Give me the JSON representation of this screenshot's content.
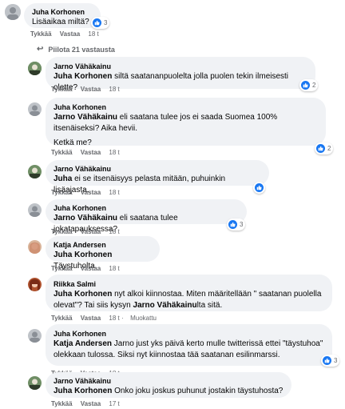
{
  "top_comment": {
    "author": "Juha Korhonen",
    "text": "Lisäaikaa miltä?",
    "likes": "3",
    "actions": {
      "like": "Tykkää",
      "reply": "Vastaa",
      "time": "18 t"
    }
  },
  "hide_replies": "Piilota 21 vastausta",
  "replies": [
    {
      "author": "Jarno Vähäkainu",
      "mention": "Juha Korhonen",
      "text": " siltä saatananpuolelta jolla puolen tekin ilmeisesti olette?",
      "likes": "2",
      "like": "Tykkää",
      "reply": "Vastaa",
      "time": "18 t"
    },
    {
      "author": "Juha Korhonen",
      "mention": "Jarno Vähäkainu",
      "text": " eli saatana tulee jos ei saada Suomea 100% itsenäiseksi? Aika hevii.",
      "text2": "Ketkä me?",
      "likes": "2",
      "like": "Tykkää",
      "reply": "Vastaa",
      "time": "18 t"
    },
    {
      "author": "Jarno Vähäkainu",
      "mention": "Juha",
      "text": " ei se itsenäisyys pelasta mitään, puhuinkin lisäajasta.",
      "likes": "",
      "like": "Tykkää",
      "reply": "Vastaa",
      "time": "18 t"
    },
    {
      "author": "Juha Korhonen",
      "mention": "Jarno Vähäkainu",
      "text": " eli saatana tulee jokatapauksessa?",
      "likes": "3",
      "like": "Tykkää",
      "reply": "Vastaa",
      "time": "18 t"
    },
    {
      "author": "Katja Andersen",
      "mention": "Juha Korhonen",
      "text": " Täystuholta.",
      "likes": "",
      "like": "Tykkää",
      "reply": "Vastaa",
      "time": "18 t"
    },
    {
      "author": "Riikka Salmi",
      "mention": "Juha Korhonen",
      "text": " nyt alkoi kiinnostaa. Miten määritellään \" saatanan puolella olevat\"? Tai siis kysyn ",
      "mention2": "Jarno Vähäkainu",
      "text_after": "lta sitä.",
      "likes": "",
      "like": "Tykkää",
      "reply": "Vastaa",
      "time": "18 t",
      "edited": "Muokattu"
    },
    {
      "author": "Juha Korhonen",
      "mention": "Katja Andersen",
      "text": " Jarno just yks päivä kerto mulle twitterissä ettei \"täystuhoa\" olekkaan tulossa. Siksi nyt kiinnostaa tää saatanan esilinmarssi.",
      "likes": "3",
      "like": "Tykkää",
      "reply": "Vastaa",
      "time": "18 t"
    },
    {
      "author": "Jarno Vähäkainu",
      "mention": "Juha Korhonen",
      "text": " Onko joku joskus puhunut jostakin täystuhosta?",
      "likes": "",
      "like": "Tykkää",
      "reply": "Vastaa",
      "time": "17 t"
    }
  ],
  "colors": {
    "like_blue": "#1877f2",
    "bubble_bg": "#f0f2f5",
    "meta_gray": "#65676b"
  },
  "icons": {
    "reaction": "thumbs-up-icon",
    "expand": "reply-arrow-icon"
  }
}
